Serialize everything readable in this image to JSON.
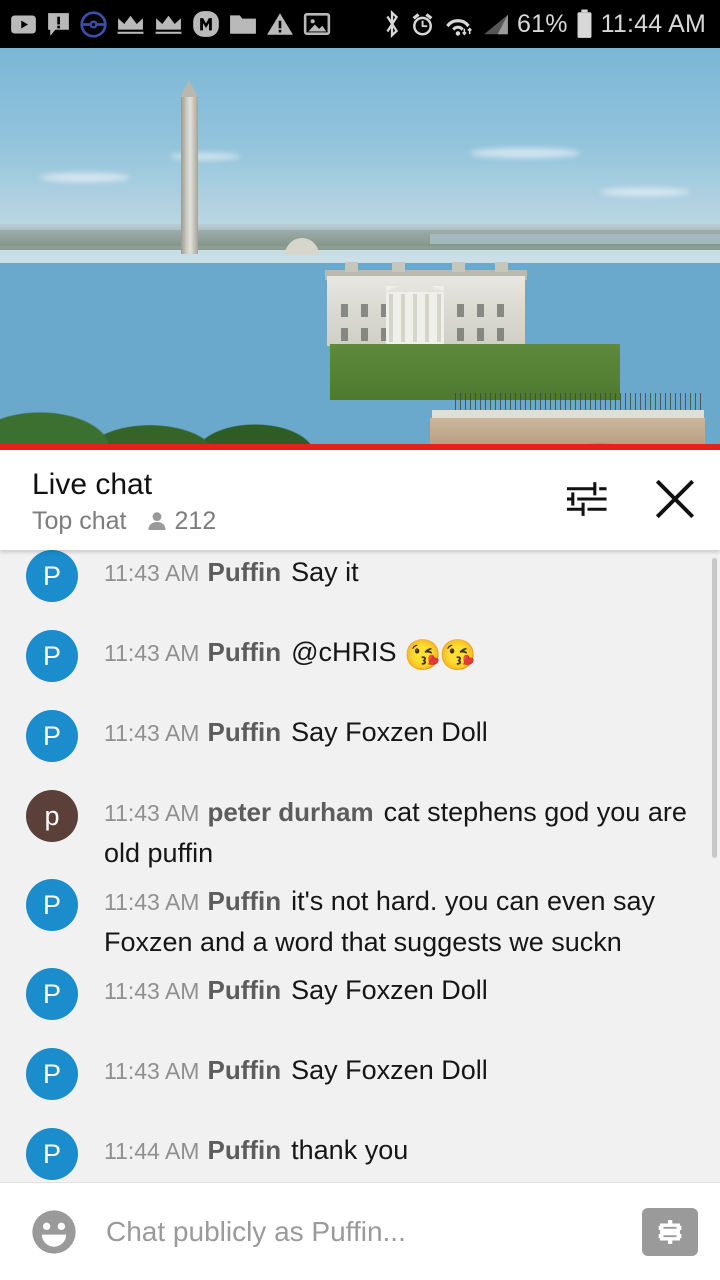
{
  "status_bar": {
    "time": "11:44 AM",
    "battery_percent": "61%",
    "icons": [
      "youtube-icon",
      "message-alert-icon",
      "pokeball-icon",
      "crown-icon",
      "crown-icon",
      "m-logo-icon",
      "folder-icon",
      "warning-triangle-icon",
      "image-icon"
    ],
    "right_icons": [
      "bluetooth-icon",
      "alarm-icon",
      "wifi-icon",
      "signal-icon",
      "battery-icon"
    ],
    "colors": {
      "background": "#000000",
      "text": "#d8d8d8",
      "pokeball": "#3b4ea8"
    }
  },
  "video": {
    "scene": "washington-monument-white-house-live-stream",
    "progress_color": "#e62117"
  },
  "chat_header": {
    "title": "Live chat",
    "mode": "Top chat",
    "viewer_count": "212",
    "viewer_icon": "person-icon",
    "settings_icon": "chat-settings-sliders-icon",
    "close_icon": "close-x-icon"
  },
  "messages": [
    {
      "time": "11:43 AM",
      "author": "Puffin",
      "text": "Say it",
      "avatar_letter": "P",
      "avatar_color": "#1b8ccc",
      "clipped": true
    },
    {
      "time": "11:43 AM",
      "author": "Puffin",
      "text": "@cHRIS ",
      "emoji": "😘😘",
      "avatar_letter": "P",
      "avatar_color": "#1b8ccc"
    },
    {
      "time": "11:43 AM",
      "author": "Puffin",
      "text": "Say Foxzen Doll",
      "avatar_letter": "P",
      "avatar_color": "#1b8ccc"
    },
    {
      "time": "11:43 AM",
      "author": "peter durham",
      "text": "cat stephens god you are old puffin",
      "avatar_letter": "p",
      "avatar_color": "#5a4038"
    },
    {
      "time": "11:43 AM",
      "author": "Puffin",
      "text": "it's not hard. you can even say Foxzen and a word that suggests we suckn",
      "avatar_letter": "P",
      "avatar_color": "#1b8ccc"
    },
    {
      "time": "11:43 AM",
      "author": "Puffin",
      "text": "Say Foxzen Doll",
      "avatar_letter": "P",
      "avatar_color": "#1b8ccc"
    },
    {
      "time": "11:43 AM",
      "author": "Puffin",
      "text": "Say Foxzen Doll",
      "avatar_letter": "P",
      "avatar_color": "#1b8ccc"
    },
    {
      "time": "11:44 AM",
      "author": "Puffin",
      "text": "thank you",
      "avatar_letter": "P",
      "avatar_color": "#1b8ccc"
    }
  ],
  "input_bar": {
    "placeholder": "Chat publicly as Puffin...",
    "value": "",
    "emoji_icon": "smiley-face-icon",
    "superchat_icon": "dollar-sign-icon"
  }
}
